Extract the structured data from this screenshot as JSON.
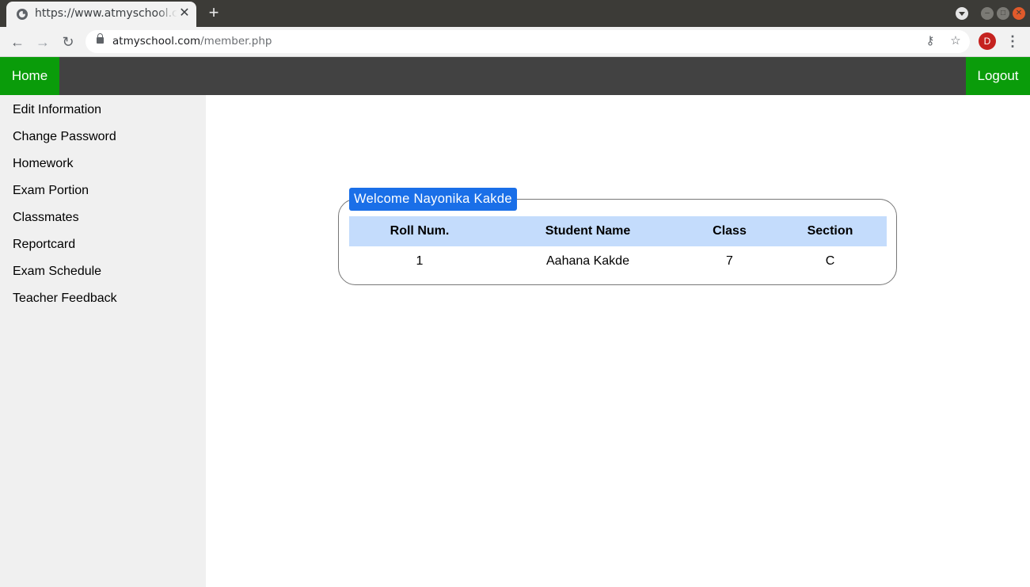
{
  "browser": {
    "tab_title": "https://www.atmyschool.com/member.php",
    "new_tab": "+",
    "url_domain": "atmyschool.com",
    "url_path": "/member.php",
    "profile_initial": "D"
  },
  "nav": {
    "home": "Home",
    "logout": "Logout"
  },
  "sidebar": {
    "items": [
      {
        "label": "Edit Information"
      },
      {
        "label": "Change Password"
      },
      {
        "label": "Homework"
      },
      {
        "label": "Exam Portion"
      },
      {
        "label": "Classmates"
      },
      {
        "label": "Reportcard"
      },
      {
        "label": "Exam Schedule"
      },
      {
        "label": "Teacher Feedback"
      }
    ]
  },
  "welcome": {
    "legend": "Welcome Nayonika Kakde",
    "columns": [
      "Roll Num.",
      "Student Name",
      "Class",
      "Section"
    ],
    "rows": [
      [
        "1",
        "Aahana Kakde",
        "7",
        "C"
      ]
    ]
  },
  "colors": {
    "nav_green": "#0a9c0a",
    "nav_dark": "#424242",
    "legend_blue": "#1a6fe8",
    "table_header": "#c4dcfc",
    "sidebar_bg": "#f0f0f0"
  }
}
